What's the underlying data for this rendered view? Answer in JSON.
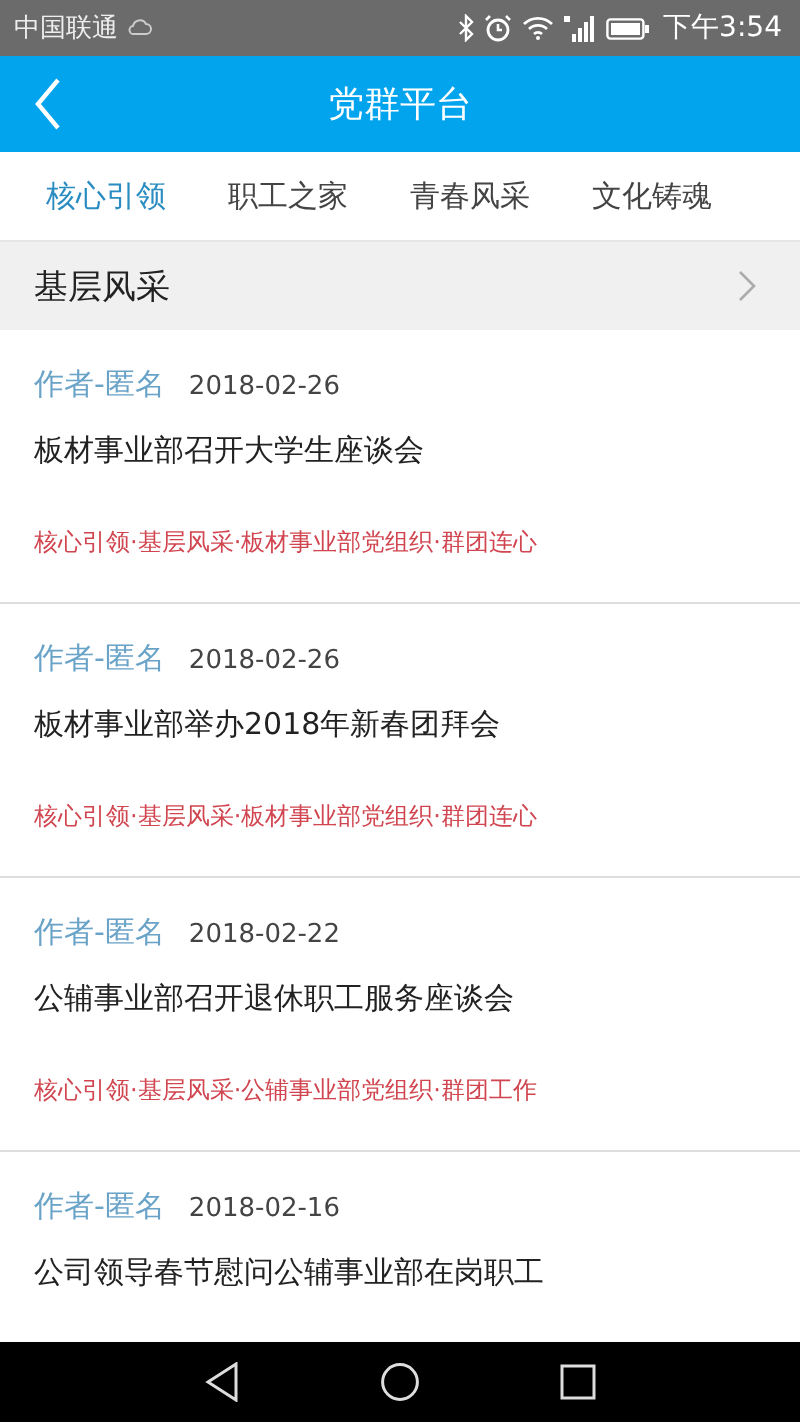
{
  "status_bar": {
    "carrier": "中国联通",
    "time": "下午3:54"
  },
  "header": {
    "title": "党群平台"
  },
  "tabs": [
    {
      "label": "核心引领",
      "selected": true
    },
    {
      "label": "职工之家",
      "selected": false
    },
    {
      "label": "青春风采",
      "selected": false
    },
    {
      "label": "文化铸魂",
      "selected": false
    }
  ],
  "section": {
    "title": "基层风采"
  },
  "articles": [
    {
      "author": "作者-匿名",
      "date": "2018-02-26",
      "title": "板材事业部召开大学生座谈会",
      "tags": "核心引领·基层风采·板材事业部党组织·群团连心"
    },
    {
      "author": "作者-匿名",
      "date": "2018-02-26",
      "title": "板材事业部举办2018年新春团拜会",
      "tags": "核心引领·基层风采·板材事业部党组织·群团连心"
    },
    {
      "author": "作者-匿名",
      "date": "2018-02-22",
      "title": "公辅事业部召开退休职工服务座谈会",
      "tags": "核心引领·基层风采·公辅事业部党组织·群团工作"
    },
    {
      "author": "作者-匿名",
      "date": "2018-02-16",
      "title": "公司领导春节慰问公辅事业部在岗职工"
    }
  ]
}
